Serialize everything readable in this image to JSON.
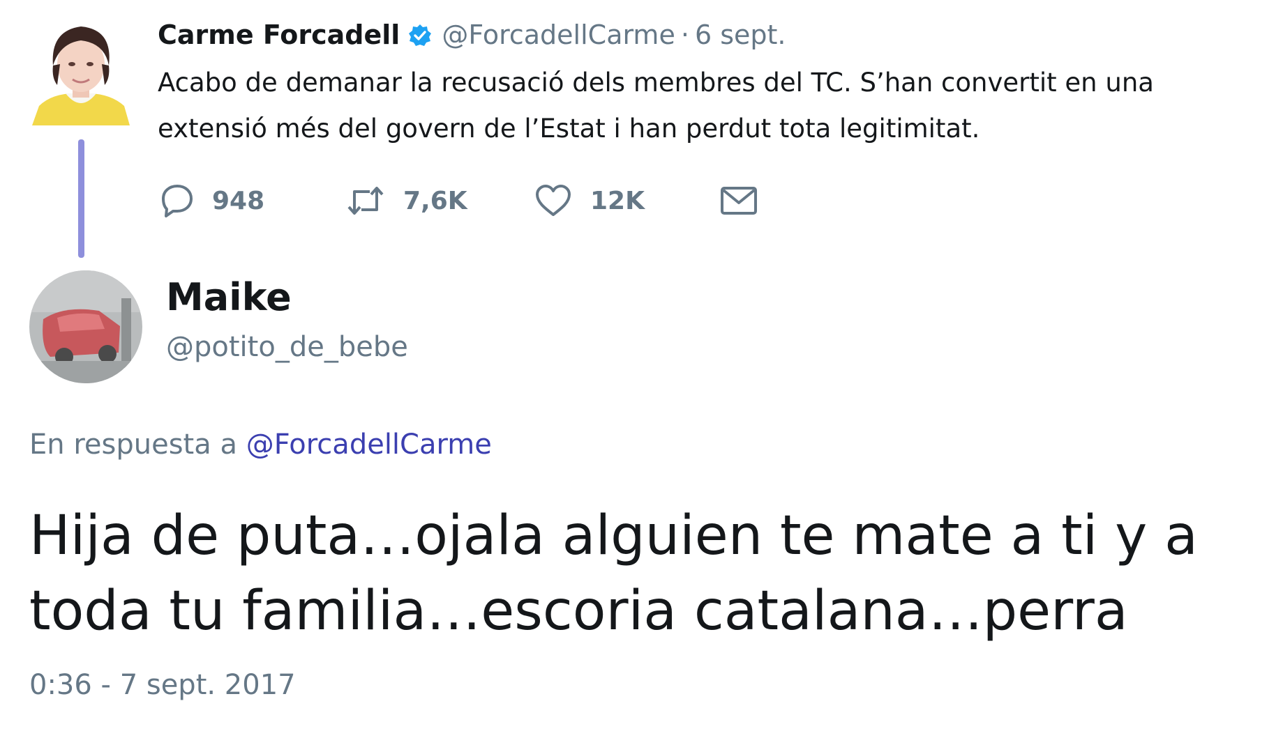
{
  "parent_tweet": {
    "display_name": "Carme Forcadell",
    "verified": true,
    "handle": "@ForcadellCarme",
    "separator": "·",
    "date": "6 sept.",
    "text": "Acabo de demanar la recusació dels membres del TC. S’han convertit en una extensió més del govern de l’Estat i han perdut tota legitimitat.",
    "actions": {
      "reply_count": "948",
      "retweet_count": "7,6K",
      "like_count": "12K"
    },
    "icons": [
      "reply-icon",
      "retweet-icon",
      "like-icon",
      "message-icon"
    ]
  },
  "reply_tweet": {
    "display_name": "Maike",
    "handle": "@potito_de_bebe",
    "replying_prefix": "En respuesta a",
    "replying_to": "@ForcadellCarme",
    "text": "Hija de puta…ojala alguien te mate a ti y a toda tu familia…escoria catalana…perra",
    "timestamp": "0:36 - 7 sept. 2017"
  },
  "colors": {
    "thread_line": "#8e8fdc",
    "verified_blue": "#1da1f2",
    "mention": "#3b3fb0",
    "secondary_text": "#657786"
  }
}
